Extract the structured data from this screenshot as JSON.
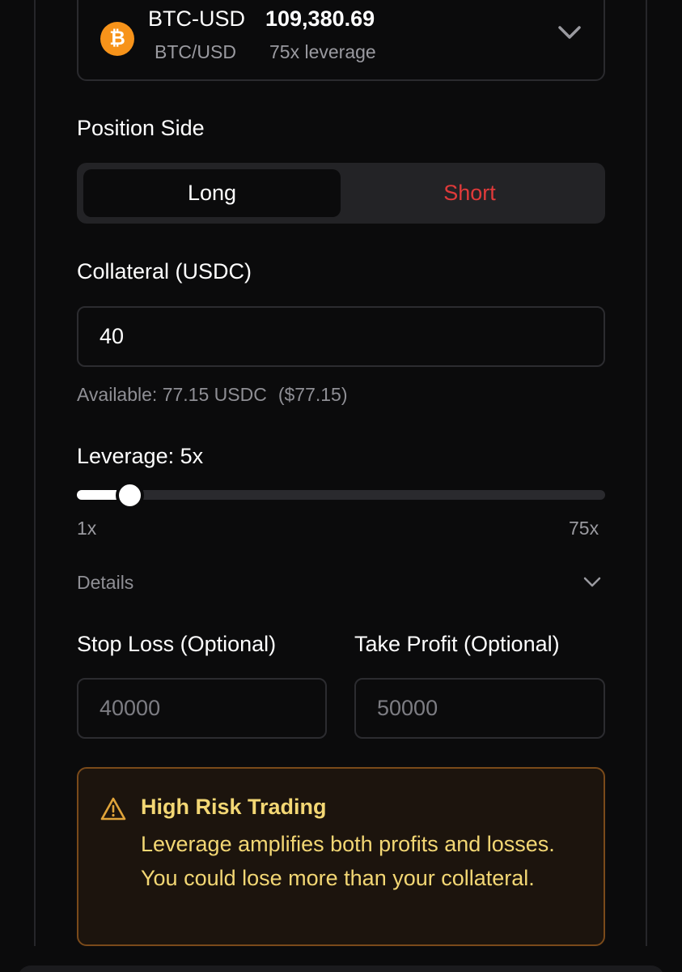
{
  "market": {
    "icon": "bitcoin-icon",
    "icon_glyph": "₿",
    "symbol": "BTC-USD",
    "price": "109,380.69",
    "pair": "BTC/USD",
    "max_leverage": "75x leverage"
  },
  "position_side": {
    "label": "Position Side",
    "long_label": "Long",
    "short_label": "Short",
    "selected": "Long"
  },
  "collateral": {
    "label": "Collateral (USDC)",
    "value": "40",
    "available": "Available: 77.15 USDC",
    "available_usd": "($77.15)"
  },
  "leverage": {
    "label": "Leverage: 5x",
    "value": 5,
    "min": 1,
    "max": 75,
    "min_label": "1x",
    "max_label": "75x"
  },
  "details": {
    "label": "Details"
  },
  "stop_loss": {
    "label": "Stop Loss (Optional)",
    "placeholder": "40000"
  },
  "take_profit": {
    "label": "Take Profit (Optional)",
    "placeholder": "50000"
  },
  "warning": {
    "title": "High Risk Trading",
    "body": "Leverage amplifies both profits and losses. You could lose more than your collateral."
  },
  "colors": {
    "background": "#0b0b0c",
    "short": "#e03a3a",
    "bitcoin": "#f7931a",
    "warning_text": "#f3d774",
    "warning_border": "#7a4a1a"
  }
}
